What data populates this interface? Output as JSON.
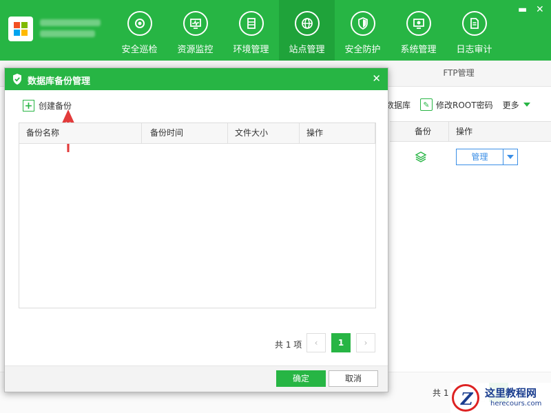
{
  "header": {
    "nav": [
      {
        "label": "安全巡检",
        "icon": "refresh-shield-icon"
      },
      {
        "label": "资源监控",
        "icon": "monitor-pulse-icon"
      },
      {
        "label": "环境管理",
        "icon": "server-icon"
      },
      {
        "label": "站点管理",
        "icon": "globe-icon",
        "active": true
      },
      {
        "label": "安全防护",
        "icon": "shield-icon"
      },
      {
        "label": "系统管理",
        "icon": "gear-screen-icon"
      },
      {
        "label": "日志审计",
        "icon": "document-icon"
      }
    ],
    "minimize": "▬",
    "close": "✕"
  },
  "background": {
    "tab_ftp": "FTP管理",
    "toolbar": {
      "db_partial": "数据库",
      "modify_root": "修改ROOT密码",
      "more": "更多"
    },
    "table": {
      "col_backup": "备份",
      "col_op": "操作",
      "manage": "管理"
    },
    "pager_total_partial": "共 1"
  },
  "dialog": {
    "title": "数据库备份管理",
    "close": "✕",
    "create_label": "创建备份",
    "columns": [
      "备份名称",
      "备份时间",
      "文件大小",
      "操作"
    ],
    "rows": [],
    "pager": {
      "total": "共 1 项",
      "prev": "‹",
      "current": "1",
      "next": "›"
    },
    "ok": "确定",
    "cancel": "取消"
  },
  "watermark": {
    "title": "这里教程网",
    "url": "herecours.com"
  },
  "colors": {
    "brand_green": "#27b544",
    "active_nav": "#1fa33a",
    "link_blue": "#3a8ee6",
    "arrow_red": "#e23b3b"
  }
}
